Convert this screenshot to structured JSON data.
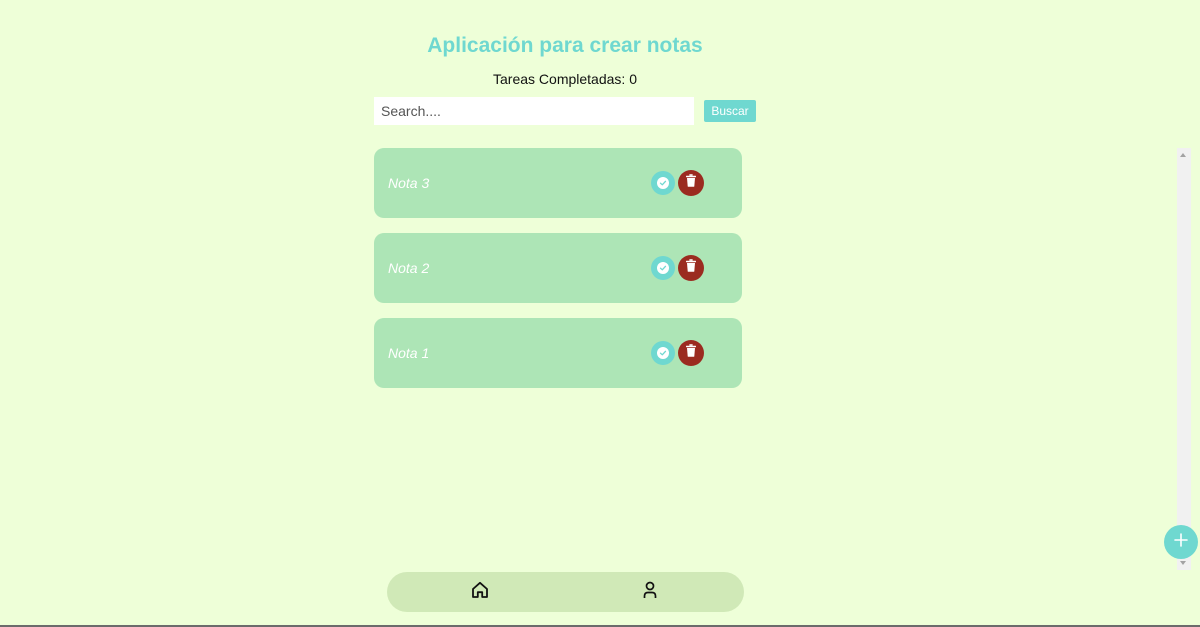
{
  "header": {
    "title": "Aplicación para crear notas",
    "completed_label": "Tareas Completadas: 0"
  },
  "search": {
    "placeholder": "Search....",
    "value": "",
    "button_label": "Buscar"
  },
  "notes": [
    {
      "text": "Nota 3",
      "complete_icon": "check-circle-icon",
      "delete_icon": "trash-icon"
    },
    {
      "text": "Nota 2",
      "complete_icon": "check-circle-icon",
      "delete_icon": "trash-icon"
    },
    {
      "text": "Nota 1",
      "complete_icon": "check-circle-icon",
      "delete_icon": "trash-icon"
    }
  ],
  "fab": {
    "icon": "plus-icon"
  },
  "bottom_nav": {
    "items": [
      {
        "icon": "home-icon"
      },
      {
        "icon": "user-icon"
      }
    ]
  },
  "colors": {
    "background": "#eeffd8",
    "accent": "#6fd8d0",
    "card": "#ade5b6",
    "delete": "#9b2b20",
    "nav": "#d0e9b7"
  }
}
